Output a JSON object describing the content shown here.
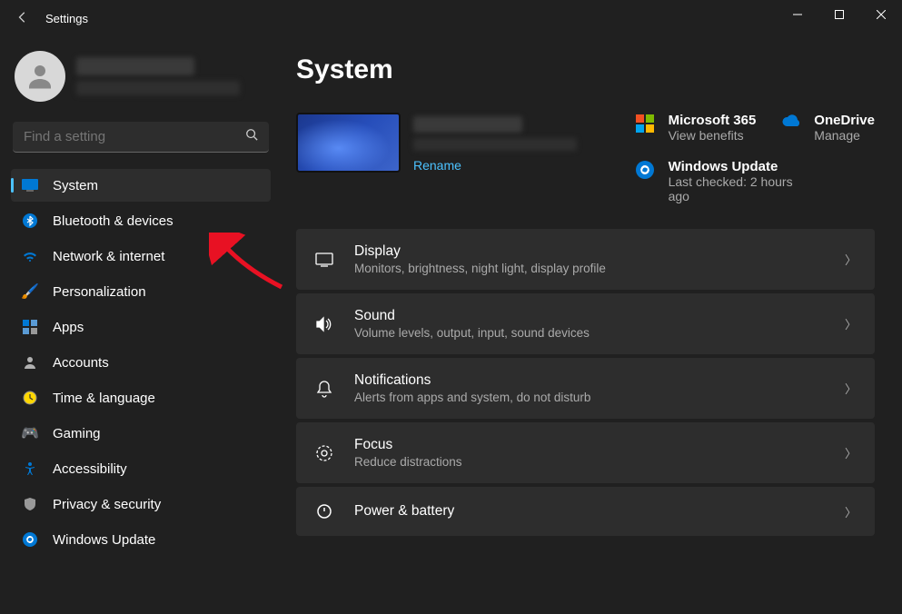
{
  "window": {
    "title": "Settings"
  },
  "search": {
    "placeholder": "Find a setting"
  },
  "sidebar": {
    "items": [
      {
        "label": "System",
        "active": true
      },
      {
        "label": "Bluetooth & devices",
        "active": false
      },
      {
        "label": "Network & internet",
        "active": false
      },
      {
        "label": "Personalization",
        "active": false
      },
      {
        "label": "Apps",
        "active": false
      },
      {
        "label": "Accounts",
        "active": false
      },
      {
        "label": "Time & language",
        "active": false
      },
      {
        "label": "Gaming",
        "active": false
      },
      {
        "label": "Accessibility",
        "active": false
      },
      {
        "label": "Privacy & security",
        "active": false
      },
      {
        "label": "Windows Update",
        "active": false
      }
    ]
  },
  "page": {
    "title": "System",
    "rename": "Rename"
  },
  "status": {
    "ms365": {
      "title": "Microsoft 365",
      "sub": "View benefits"
    },
    "onedrive": {
      "title": "OneDrive",
      "sub": "Manage"
    },
    "update": {
      "title": "Windows Update",
      "sub": "Last checked: 2 hours ago"
    }
  },
  "settings": [
    {
      "title": "Display",
      "desc": "Monitors, brightness, night light, display profile"
    },
    {
      "title": "Sound",
      "desc": "Volume levels, output, input, sound devices"
    },
    {
      "title": "Notifications",
      "desc": "Alerts from apps and system, do not disturb"
    },
    {
      "title": "Focus",
      "desc": "Reduce distractions"
    },
    {
      "title": "Power & battery",
      "desc": ""
    }
  ]
}
